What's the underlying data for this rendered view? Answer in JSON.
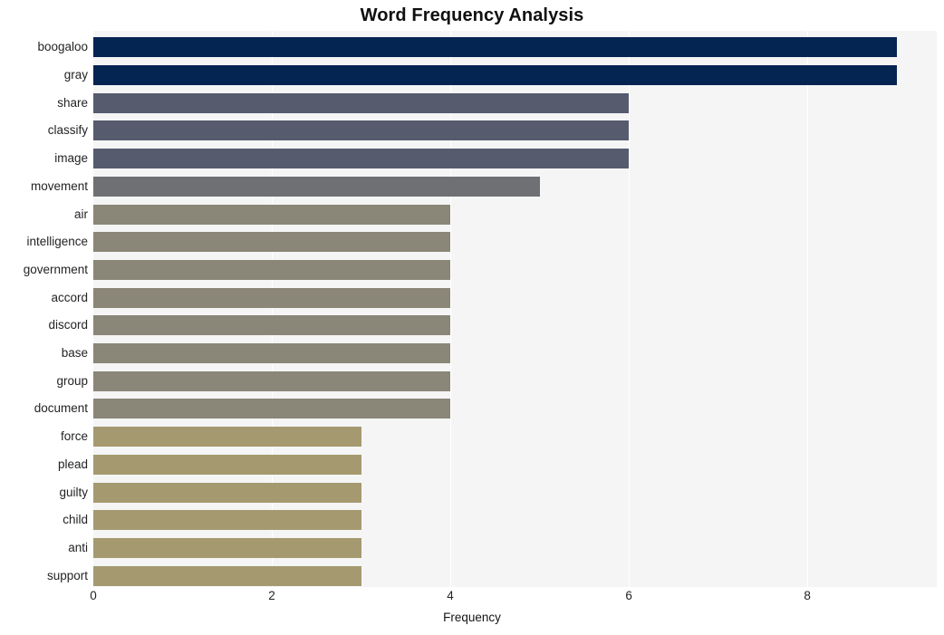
{
  "chart_data": {
    "type": "bar",
    "orientation": "horizontal",
    "title": "Word Frequency Analysis",
    "xlabel": "Frequency",
    "ylabel": "",
    "categories": [
      "boogaloo",
      "gray",
      "share",
      "classify",
      "image",
      "movement",
      "air",
      "intelligence",
      "government",
      "accord",
      "discord",
      "base",
      "group",
      "document",
      "force",
      "plead",
      "guilty",
      "child",
      "anti",
      "support"
    ],
    "values": [
      9,
      9,
      6,
      6,
      6,
      5,
      4,
      4,
      4,
      4,
      4,
      4,
      4,
      4,
      3,
      3,
      3,
      3,
      3,
      3
    ],
    "bar_colors": [
      "#042451",
      "#042451",
      "#575b6e",
      "#575b6e",
      "#575b6e",
      "#6e7073",
      "#8a8678",
      "#8a8678",
      "#8a8678",
      "#8a8678",
      "#8a8678",
      "#8a8678",
      "#8a8678",
      "#8a8678",
      "#a59a6f",
      "#a59a6f",
      "#a59a6f",
      "#a59a6f",
      "#a59a6f",
      "#a59a6f"
    ],
    "xlim": [
      0,
      9.45
    ],
    "x_ticks": [
      0,
      2,
      4,
      6,
      8
    ],
    "x_tick_labels": [
      "0",
      "2",
      "4",
      "6",
      "8"
    ],
    "grid": true,
    "grid_color": "#ffffff",
    "plot_background": "#f5f5f6",
    "figure_background": "#ffffff",
    "legend": null
  }
}
